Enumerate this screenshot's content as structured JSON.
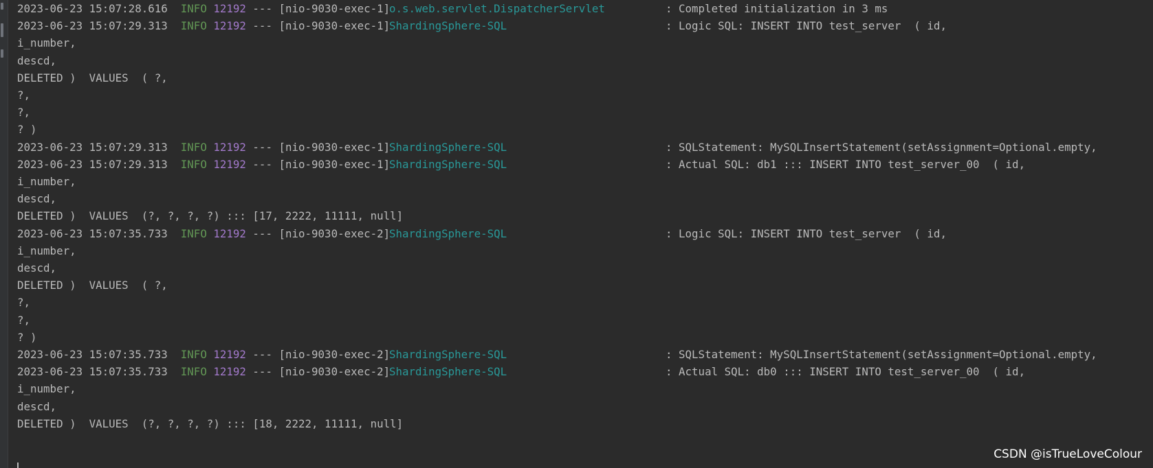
{
  "log_lines": [
    {
      "type": "entry",
      "timestamp": "2023-06-23 15:07:28.616",
      "level": "INFO",
      "pid": "12192",
      "sep": "---",
      "thread": "[nio-9030-exec-1]",
      "logger": "o.s.web.servlet.DispatcherServlet",
      "message": ": Completed initialization in 3 ms"
    },
    {
      "type": "entry",
      "timestamp": "2023-06-23 15:07:29.313",
      "level": "INFO",
      "pid": "12192",
      "sep": "---",
      "thread": "[nio-9030-exec-1]",
      "logger": "ShardingSphere-SQL",
      "message": ": Logic SQL: INSERT INTO test_server  ( id,"
    },
    {
      "type": "cont",
      "text": "i_number,"
    },
    {
      "type": "cont",
      "text": "descd,"
    },
    {
      "type": "cont",
      "text": "DELETED )  VALUES  ( ?,"
    },
    {
      "type": "cont",
      "text": "?,"
    },
    {
      "type": "cont",
      "text": "?,"
    },
    {
      "type": "cont",
      "text": "? )"
    },
    {
      "type": "entry",
      "timestamp": "2023-06-23 15:07:29.313",
      "level": "INFO",
      "pid": "12192",
      "sep": "---",
      "thread": "[nio-9030-exec-1]",
      "logger": "ShardingSphere-SQL",
      "message": ": SQLStatement: MySQLInsertStatement(setAssignment=Optional.empty,"
    },
    {
      "type": "entry",
      "timestamp": "2023-06-23 15:07:29.313",
      "level": "INFO",
      "pid": "12192",
      "sep": "---",
      "thread": "[nio-9030-exec-1]",
      "logger": "ShardingSphere-SQL",
      "message": ": Actual SQL: db1 ::: INSERT INTO test_server_00  ( id,"
    },
    {
      "type": "cont",
      "text": "i_number,"
    },
    {
      "type": "cont",
      "text": "descd,"
    },
    {
      "type": "cont",
      "text": "DELETED )  VALUES  (?, ?, ?, ?) ::: [17, 2222, 11111, null]"
    },
    {
      "type": "entry",
      "timestamp": "2023-06-23 15:07:35.733",
      "level": "INFO",
      "pid": "12192",
      "sep": "---",
      "thread": "[nio-9030-exec-2]",
      "logger": "ShardingSphere-SQL",
      "message": ": Logic SQL: INSERT INTO test_server  ( id,"
    },
    {
      "type": "cont",
      "text": "i_number,"
    },
    {
      "type": "cont",
      "text": "descd,"
    },
    {
      "type": "cont",
      "text": "DELETED )  VALUES  ( ?,"
    },
    {
      "type": "cont",
      "text": "?,"
    },
    {
      "type": "cont",
      "text": "?,"
    },
    {
      "type": "cont",
      "text": "? )"
    },
    {
      "type": "entry",
      "timestamp": "2023-06-23 15:07:35.733",
      "level": "INFO",
      "pid": "12192",
      "sep": "---",
      "thread": "[nio-9030-exec-2]",
      "logger": "ShardingSphere-SQL",
      "message": ": SQLStatement: MySQLInsertStatement(setAssignment=Optional.empty,"
    },
    {
      "type": "entry",
      "timestamp": "2023-06-23 15:07:35.733",
      "level": "INFO",
      "pid": "12192",
      "sep": "---",
      "thread": "[nio-9030-exec-2]",
      "logger": "ShardingSphere-SQL",
      "message": ": Actual SQL: db0 ::: INSERT INTO test_server_00  ( id,"
    },
    {
      "type": "cont",
      "text": "i_number,"
    },
    {
      "type": "cont",
      "text": "descd,"
    },
    {
      "type": "cont",
      "text": "DELETED )  VALUES  (?, ?, ?, ?) ::: [18, 2222, 11111, null]"
    }
  ],
  "watermark": "CSDN @isTrueLoveColour",
  "colors": {
    "background": "#2b2b2b",
    "text": "#bababa",
    "level_info": "#629755",
    "pid": "#a37acc",
    "logger": "#299999"
  }
}
